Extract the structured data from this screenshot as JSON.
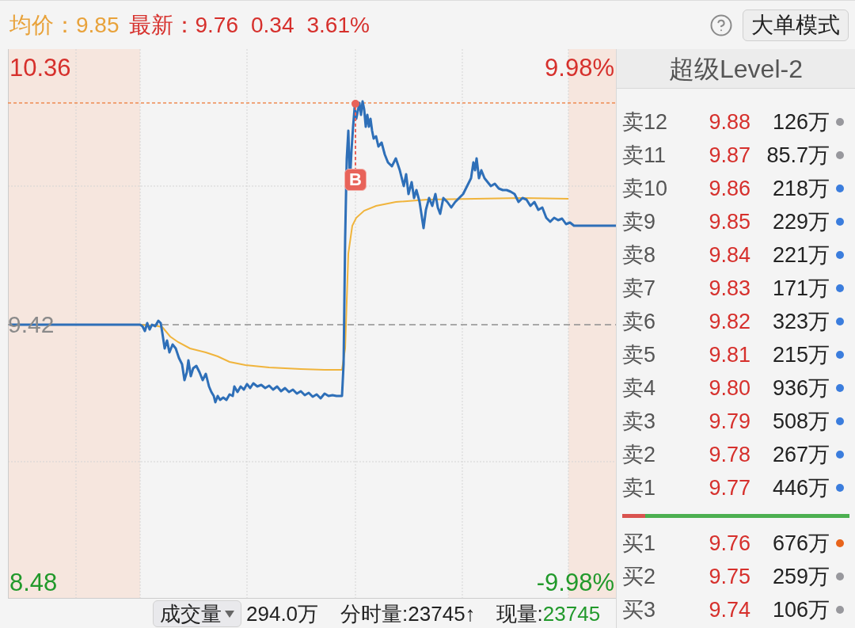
{
  "header": {
    "average_label": "均价：",
    "average_price": "9.85",
    "latest_label": "最新：",
    "latest_price": "9.76",
    "change": "0.34",
    "change_percent": "3.61%",
    "mode_button": "大单模式"
  },
  "chart": {
    "high_price": "10.36",
    "high_percent": "9.98%",
    "base_price": "9.42",
    "low_price": "8.48",
    "low_percent": "-9.98%",
    "trade_marker": "B"
  },
  "order_book": {
    "title": "超级Level-2",
    "asks": [
      {
        "label": "卖12",
        "price": "9.88",
        "volume": "126万",
        "color": "#98989d"
      },
      {
        "label": "卖11",
        "price": "9.87",
        "volume": "85.7万",
        "color": "#98989d"
      },
      {
        "label": "卖10",
        "price": "9.86",
        "volume": "218万",
        "color": "#3b7ddd"
      },
      {
        "label": "卖9",
        "price": "9.85",
        "volume": "229万",
        "color": "#3b7ddd"
      },
      {
        "label": "卖8",
        "price": "9.84",
        "volume": "221万",
        "color": "#3b7ddd"
      },
      {
        "label": "卖7",
        "price": "9.83",
        "volume": "171万",
        "color": "#3b7ddd"
      },
      {
        "label": "卖6",
        "price": "9.82",
        "volume": "323万",
        "color": "#3b7ddd"
      },
      {
        "label": "卖5",
        "price": "9.81",
        "volume": "215万",
        "color": "#3b7ddd"
      },
      {
        "label": "卖4",
        "price": "9.80",
        "volume": "936万",
        "color": "#3b7ddd"
      },
      {
        "label": "卖3",
        "price": "9.79",
        "volume": "508万",
        "color": "#3b7ddd"
      },
      {
        "label": "卖2",
        "price": "9.78",
        "volume": "267万",
        "color": "#3b7ddd"
      },
      {
        "label": "卖1",
        "price": "9.77",
        "volume": "446万",
        "color": "#3b7ddd"
      }
    ],
    "ratio_bar": {
      "level": 0.1
    },
    "bids": [
      {
        "label": "买1",
        "price": "9.76",
        "volume": "676万",
        "color": "#e8641b"
      },
      {
        "label": "买2",
        "price": "9.75",
        "volume": "259万",
        "color": "#98989d"
      },
      {
        "label": "买3",
        "price": "9.74",
        "volume": "106万",
        "color": "#98989d"
      }
    ]
  },
  "footer": {
    "volume_selector": "成交量",
    "total_volume": "294.0万",
    "tick_volume": "分时量:23745↑",
    "current_label": "现量:",
    "current_volume": "23745"
  }
}
